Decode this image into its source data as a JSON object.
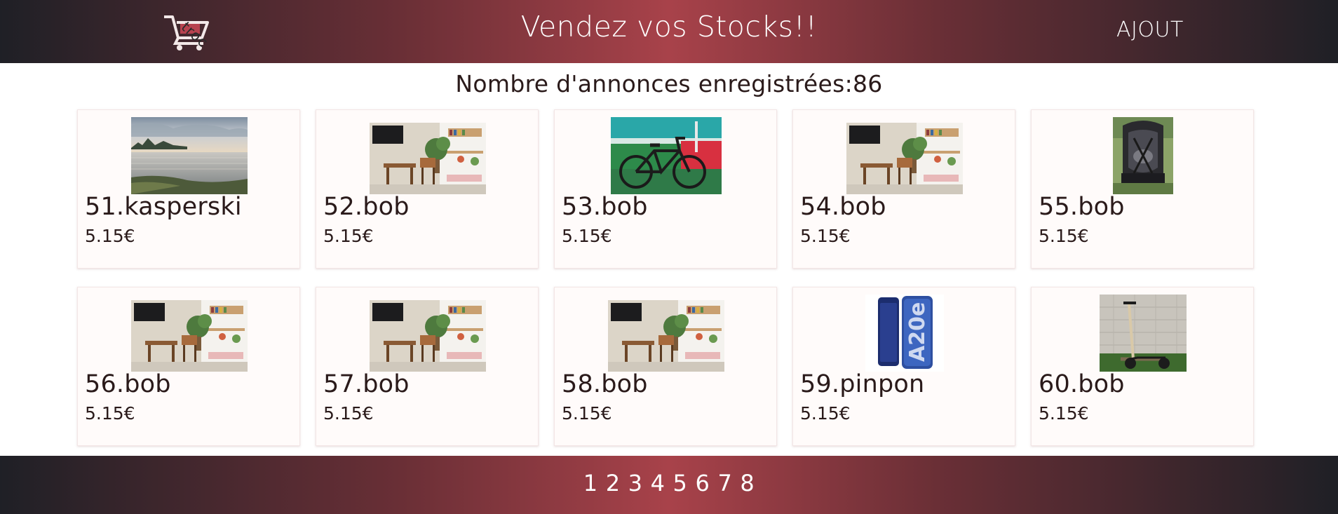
{
  "header": {
    "logo_text": "troc",
    "title": "Vendez vos Stocks!!",
    "add_label": "AJOUT"
  },
  "listing": {
    "count_text": "Nombre d'annonces enregistrées:86"
  },
  "cards": [
    {
      "title": "51.kasperski",
      "price": "5.15€",
      "image": "lake-landscape"
    },
    {
      "title": "52.bob",
      "price": "5.15€",
      "image": "living-room"
    },
    {
      "title": "53.bob",
      "price": "5.15€",
      "image": "bicycle"
    },
    {
      "title": "54.bob",
      "price": "5.15€",
      "image": "living-room"
    },
    {
      "title": "55.bob",
      "price": "5.15€",
      "image": "car-seat"
    },
    {
      "title": "56.bob",
      "price": "5.15€",
      "image": "living-room"
    },
    {
      "title": "57.bob",
      "price": "5.15€",
      "image": "living-room"
    },
    {
      "title": "58.bob",
      "price": "5.15€",
      "image": "living-room"
    },
    {
      "title": "59.pinpon",
      "price": "5.15€",
      "image": "phone",
      "phone_text": "A20e"
    },
    {
      "title": "60.bob",
      "price": "5.15€",
      "image": "scooter"
    }
  ],
  "pagination": {
    "pages": [
      "1",
      "2",
      "3",
      "4",
      "5",
      "6",
      "7",
      "8"
    ]
  },
  "colors": {
    "gradient_center": "#a8424a",
    "gradient_edge": "#1f2026",
    "card_background": "#fffbfa"
  }
}
